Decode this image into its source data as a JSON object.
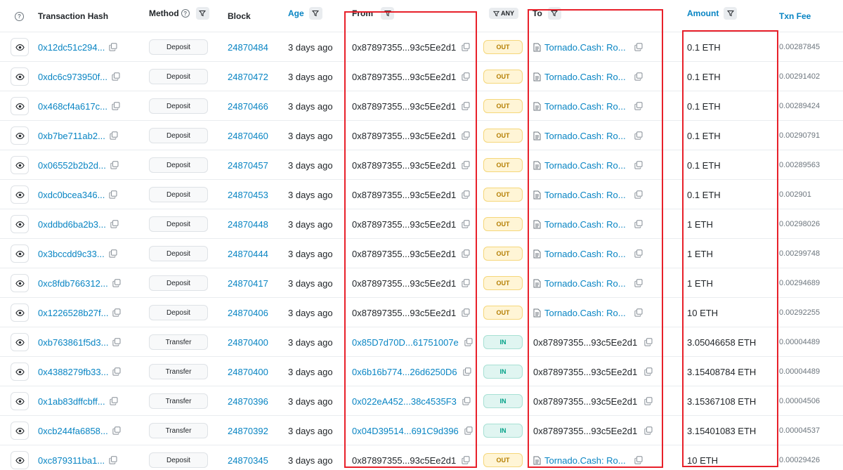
{
  "header": {
    "info_icon": "?",
    "txn_hash": "Transaction Hash",
    "method": "Method",
    "method_help": "?",
    "block": "Block",
    "age": "Age",
    "from": "From",
    "any": "ANY",
    "to": "To",
    "amount": "Amount",
    "txn_fee": "Txn Fee"
  },
  "colors": {
    "link": "#0784c3",
    "highlight_border": "#e8202a",
    "out_badge": "#fff5d6",
    "in_badge": "#e0f5f1"
  },
  "rows": [
    {
      "hash": "0x12dc51c294...",
      "method": "Deposit",
      "block": "24870484",
      "age": "3 days ago",
      "from": "0x87897355...93c5Ee2d1",
      "from_link": false,
      "dir": "OUT",
      "to": "Tornado.Cash: Ro...",
      "to_contract": true,
      "amount": "0.1 ETH",
      "fee": "0.00287845"
    },
    {
      "hash": "0xdc6c973950f...",
      "method": "Deposit",
      "block": "24870472",
      "age": "3 days ago",
      "from": "0x87897355...93c5Ee2d1",
      "from_link": false,
      "dir": "OUT",
      "to": "Tornado.Cash: Ro...",
      "to_contract": true,
      "amount": "0.1 ETH",
      "fee": "0.00291402"
    },
    {
      "hash": "0x468cf4a617c...",
      "method": "Deposit",
      "block": "24870466",
      "age": "3 days ago",
      "from": "0x87897355...93c5Ee2d1",
      "from_link": false,
      "dir": "OUT",
      "to": "Tornado.Cash: Ro...",
      "to_contract": true,
      "amount": "0.1 ETH",
      "fee": "0.00289424"
    },
    {
      "hash": "0xb7be711ab2...",
      "method": "Deposit",
      "block": "24870460",
      "age": "3 days ago",
      "from": "0x87897355...93c5Ee2d1",
      "from_link": false,
      "dir": "OUT",
      "to": "Tornado.Cash: Ro...",
      "to_contract": true,
      "amount": "0.1 ETH",
      "fee": "0.00290791"
    },
    {
      "hash": "0x06552b2b2d...",
      "method": "Deposit",
      "block": "24870457",
      "age": "3 days ago",
      "from": "0x87897355...93c5Ee2d1",
      "from_link": false,
      "dir": "OUT",
      "to": "Tornado.Cash: Ro...",
      "to_contract": true,
      "amount": "0.1 ETH",
      "fee": "0.00289563"
    },
    {
      "hash": "0xdc0bcea346...",
      "method": "Deposit",
      "block": "24870453",
      "age": "3 days ago",
      "from": "0x87897355...93c5Ee2d1",
      "from_link": false,
      "dir": "OUT",
      "to": "Tornado.Cash: Ro...",
      "to_contract": true,
      "amount": "0.1 ETH",
      "fee": "0.002901"
    },
    {
      "hash": "0xddbd6ba2b3...",
      "method": "Deposit",
      "block": "24870448",
      "age": "3 days ago",
      "from": "0x87897355...93c5Ee2d1",
      "from_link": false,
      "dir": "OUT",
      "to": "Tornado.Cash: Ro...",
      "to_contract": true,
      "amount": "1 ETH",
      "fee": "0.00298026"
    },
    {
      "hash": "0x3bccdd9c33...",
      "method": "Deposit",
      "block": "24870444",
      "age": "3 days ago",
      "from": "0x87897355...93c5Ee2d1",
      "from_link": false,
      "dir": "OUT",
      "to": "Tornado.Cash: Ro...",
      "to_contract": true,
      "amount": "1 ETH",
      "fee": "0.00299748"
    },
    {
      "hash": "0xc8fdb766312...",
      "method": "Deposit",
      "block": "24870417",
      "age": "3 days ago",
      "from": "0x87897355...93c5Ee2d1",
      "from_link": false,
      "dir": "OUT",
      "to": "Tornado.Cash: Ro...",
      "to_contract": true,
      "amount": "1 ETH",
      "fee": "0.00294689"
    },
    {
      "hash": "0x1226528b27f...",
      "method": "Deposit",
      "block": "24870406",
      "age": "3 days ago",
      "from": "0x87897355...93c5Ee2d1",
      "from_link": false,
      "dir": "OUT",
      "to": "Tornado.Cash: Ro...",
      "to_contract": true,
      "amount": "10 ETH",
      "fee": "0.00292255"
    },
    {
      "hash": "0xb763861f5d3...",
      "method": "Transfer",
      "block": "24870400",
      "age": "3 days ago",
      "from": "0x85D7d70D...61751007e",
      "from_link": true,
      "dir": "IN",
      "to": "0x87897355...93c5Ee2d1",
      "to_contract": false,
      "amount": "3.05046658 ETH",
      "fee": "0.00004489"
    },
    {
      "hash": "0x4388279fb33...",
      "method": "Transfer",
      "block": "24870400",
      "age": "3 days ago",
      "from": "0x6b16b774...26d6250D6",
      "from_link": true,
      "dir": "IN",
      "to": "0x87897355...93c5Ee2d1",
      "to_contract": false,
      "amount": "3.15408784 ETH",
      "fee": "0.00004489"
    },
    {
      "hash": "0x1ab83dffcbff...",
      "method": "Transfer",
      "block": "24870396",
      "age": "3 days ago",
      "from": "0x022eA452...38c4535F3",
      "from_link": true,
      "dir": "IN",
      "to": "0x87897355...93c5Ee2d1",
      "to_contract": false,
      "amount": "3.15367108 ETH",
      "fee": "0.00004506"
    },
    {
      "hash": "0xcb244fa6858...",
      "method": "Transfer",
      "block": "24870392",
      "age": "3 days ago",
      "from": "0x04D39514...691C9d396",
      "from_link": true,
      "dir": "IN",
      "to": "0x87897355...93c5Ee2d1",
      "to_contract": false,
      "amount": "3.15401083 ETH",
      "fee": "0.00004537"
    },
    {
      "hash": "0xc879311ba1...",
      "method": "Deposit",
      "block": "24870345",
      "age": "3 days ago",
      "from": "0x87897355...93c5Ee2d1",
      "from_link": false,
      "dir": "OUT",
      "to": "Tornado.Cash: Ro...",
      "to_contract": true,
      "amount": "10 ETH",
      "fee": "0.00029426"
    }
  ]
}
